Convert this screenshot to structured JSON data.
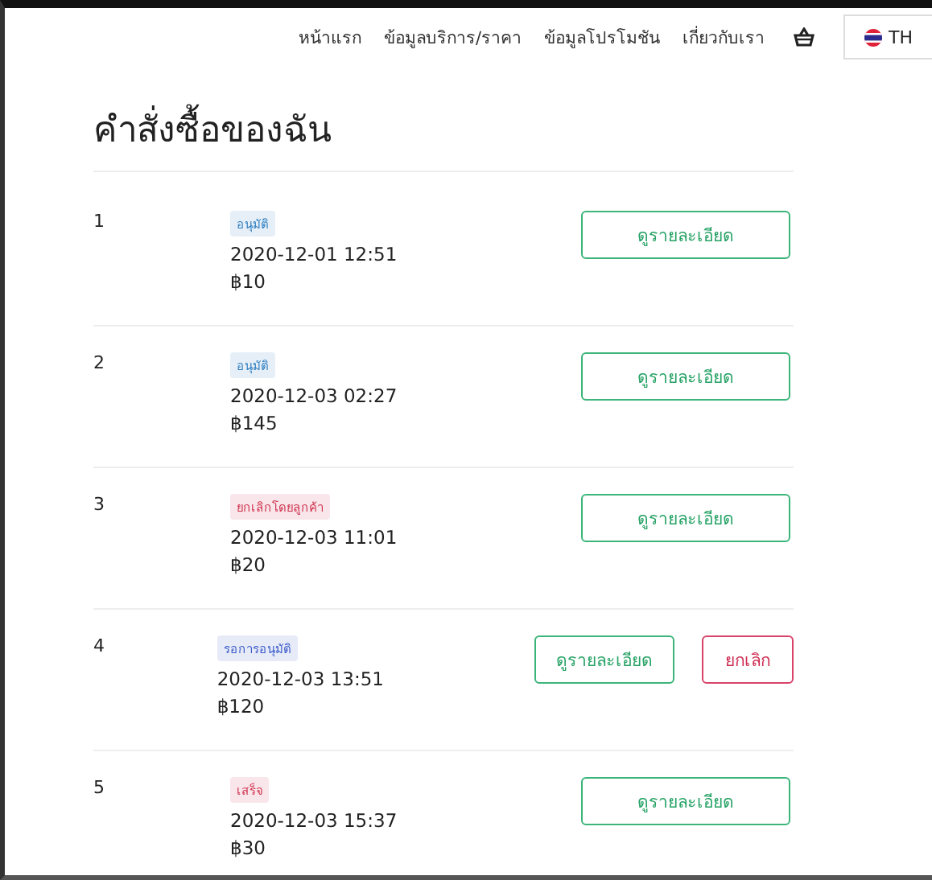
{
  "nav": {
    "links": [
      "หน้าแรก",
      "ข้อมูลบริการ/ราคา",
      "ข้อมูลโปรโมชัน",
      "เกี่ยวกับเรา"
    ],
    "language": "TH"
  },
  "title": "คำสั่งซื้อของฉัน",
  "orders": [
    {
      "number": "1",
      "status": "อนุมัติ",
      "color": "#2f7fc1",
      "datetime": "2020-12-01 12:51",
      "amount": "฿10",
      "actions": [
        {
          "kind": "details",
          "label": "ดูรายละเอียด"
        }
      ]
    },
    {
      "number": "2",
      "status": "อนุมัติ",
      "color": "#2f7fc1",
      "datetime": "2020-12-03 02:27",
      "amount": "฿145",
      "actions": [
        {
          "kind": "details",
          "label": "ดูรายละเอียด"
        }
      ]
    },
    {
      "number": "3",
      "status": "ยกเลิกโดยลูกค้า",
      "color": "#d0324f",
      "datetime": "2020-12-03 11:01",
      "amount": "฿20",
      "actions": [
        {
          "kind": "details",
          "label": "ดูรายละเอียด"
        }
      ]
    },
    {
      "number": "4",
      "status": "รอการอนุมัติ",
      "color": "#3b5bc9",
      "datetime": "2020-12-03 13:51",
      "amount": "฿120",
      "actions": [
        {
          "kind": "details",
          "label": "ดูรายละเอียด"
        },
        {
          "kind": "cancel",
          "label": "ยกเลิก"
        }
      ]
    },
    {
      "number": "5",
      "status": "เสร็จ",
      "color": "#d0324f",
      "datetime": "2020-12-03 15:37",
      "amount": "฿30",
      "actions": [
        {
          "kind": "details",
          "label": "ดูรายละเอียด"
        }
      ]
    }
  ]
}
